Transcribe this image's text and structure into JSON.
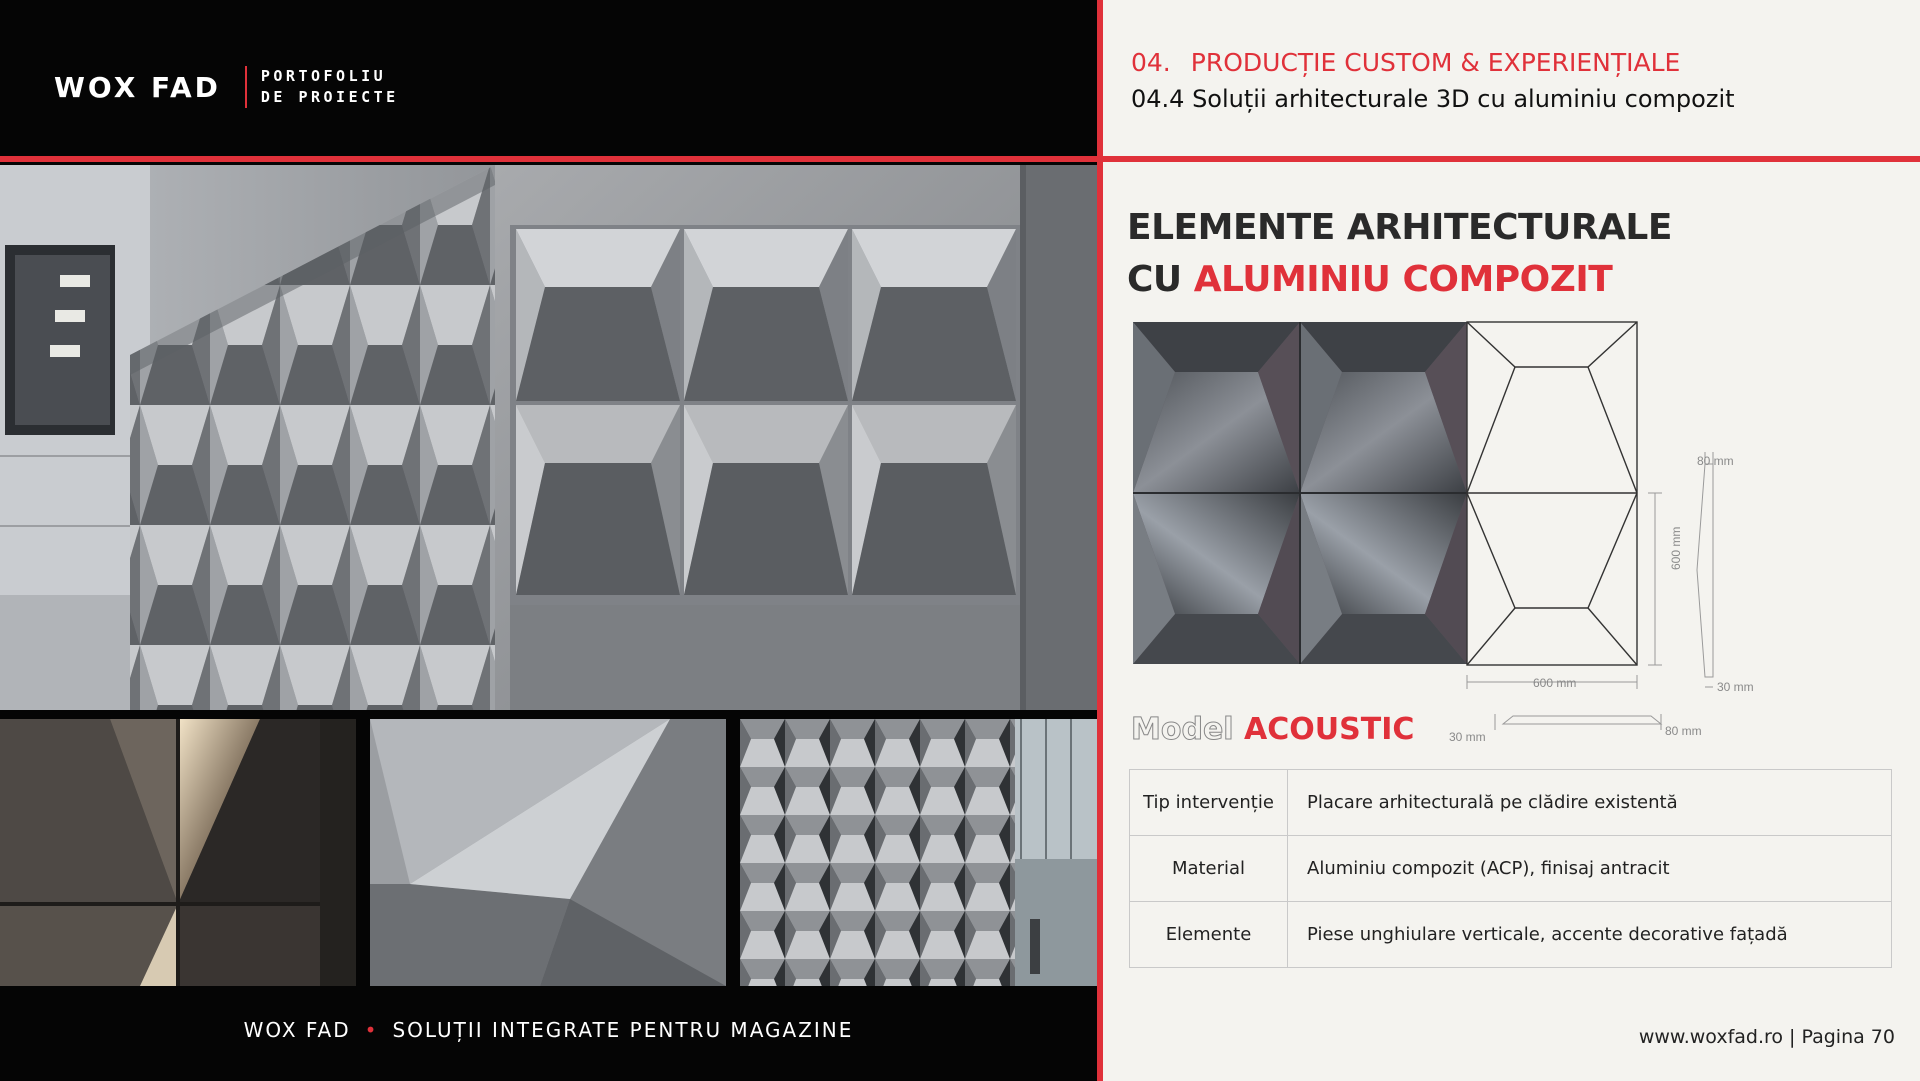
{
  "brand": {
    "name": "WOX FAD",
    "sub_line1": "PORTOFOLIU",
    "sub_line2": "DE PROIECTE"
  },
  "footer_left": {
    "brand": "WOX FAD",
    "separator": "•",
    "tagline": "SOLUȚII  INTEGRATE  PENTRU  MAGAZINE"
  },
  "section": {
    "number": "04.",
    "title": "PRODUCȚIE CUSTOM & EXPERIENȚIALE",
    "subtitle": "04.4  Soluții arhitecturale 3D cu aluminiu compozit"
  },
  "heading": {
    "line1": "ELEMENTE ARHITECTURALE",
    "line2_prefix": "CU ",
    "line2_accent": "ALUMINIU COMPOZIT"
  },
  "drawing": {
    "dim_width": "600 mm",
    "dim_height": "600 mm",
    "dim_depth_top": "80 mm",
    "dim_depth_side": "30 mm",
    "dim_bottom_left": "30 mm",
    "dim_bottom_right": "80 mm"
  },
  "model": {
    "label": "Model",
    "name": "ACOUSTIC"
  },
  "spec_table": [
    {
      "key": "Tip intervenție",
      "value": "Placare arhitecturală pe clădire existentă"
    },
    {
      "key": "Material",
      "value": "Aluminiu compozit (ACP), finisaj antracit"
    },
    {
      "key": "Elemente",
      "value": "Piese unghiulare verticale, accente decorative fațadă"
    }
  ],
  "page_footer": "www.woxfad.ro | Pagina 70",
  "colors": {
    "accent": "#e0313a",
    "dark": "#050505",
    "background": "#f4f3ef"
  }
}
